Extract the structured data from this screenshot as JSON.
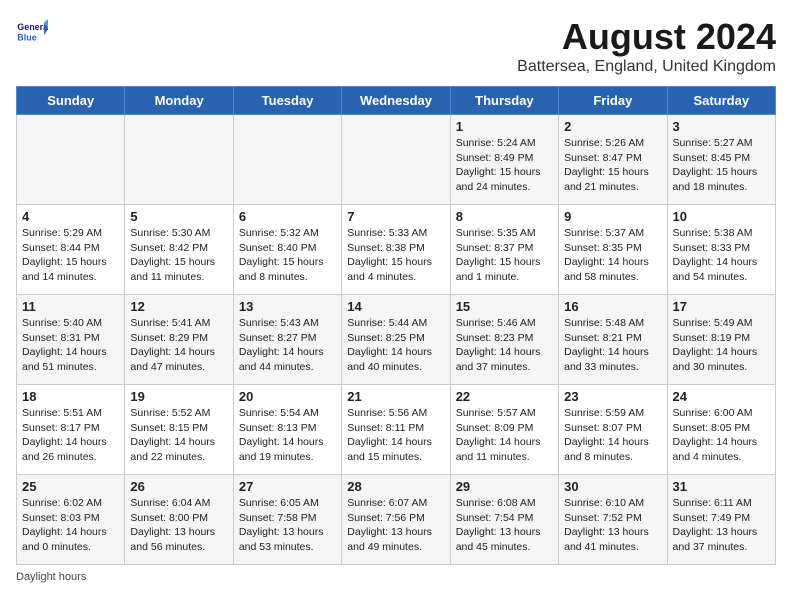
{
  "header": {
    "logo_line1": "General",
    "logo_line2": "Blue",
    "title": "August 2024",
    "subtitle": "Battersea, England, United Kingdom"
  },
  "days_of_week": [
    "Sunday",
    "Monday",
    "Tuesday",
    "Wednesday",
    "Thursday",
    "Friday",
    "Saturday"
  ],
  "weeks": [
    [
      {
        "day": "",
        "info": ""
      },
      {
        "day": "",
        "info": ""
      },
      {
        "day": "",
        "info": ""
      },
      {
        "day": "",
        "info": ""
      },
      {
        "day": "1",
        "info": "Sunrise: 5:24 AM\nSunset: 8:49 PM\nDaylight: 15 hours\nand 24 minutes."
      },
      {
        "day": "2",
        "info": "Sunrise: 5:26 AM\nSunset: 8:47 PM\nDaylight: 15 hours\nand 21 minutes."
      },
      {
        "day": "3",
        "info": "Sunrise: 5:27 AM\nSunset: 8:45 PM\nDaylight: 15 hours\nand 18 minutes."
      }
    ],
    [
      {
        "day": "4",
        "info": "Sunrise: 5:29 AM\nSunset: 8:44 PM\nDaylight: 15 hours\nand 14 minutes."
      },
      {
        "day": "5",
        "info": "Sunrise: 5:30 AM\nSunset: 8:42 PM\nDaylight: 15 hours\nand 11 minutes."
      },
      {
        "day": "6",
        "info": "Sunrise: 5:32 AM\nSunset: 8:40 PM\nDaylight: 15 hours\nand 8 minutes."
      },
      {
        "day": "7",
        "info": "Sunrise: 5:33 AM\nSunset: 8:38 PM\nDaylight: 15 hours\nand 4 minutes."
      },
      {
        "day": "8",
        "info": "Sunrise: 5:35 AM\nSunset: 8:37 PM\nDaylight: 15 hours\nand 1 minute."
      },
      {
        "day": "9",
        "info": "Sunrise: 5:37 AM\nSunset: 8:35 PM\nDaylight: 14 hours\nand 58 minutes."
      },
      {
        "day": "10",
        "info": "Sunrise: 5:38 AM\nSunset: 8:33 PM\nDaylight: 14 hours\nand 54 minutes."
      }
    ],
    [
      {
        "day": "11",
        "info": "Sunrise: 5:40 AM\nSunset: 8:31 PM\nDaylight: 14 hours\nand 51 minutes."
      },
      {
        "day": "12",
        "info": "Sunrise: 5:41 AM\nSunset: 8:29 PM\nDaylight: 14 hours\nand 47 minutes."
      },
      {
        "day": "13",
        "info": "Sunrise: 5:43 AM\nSunset: 8:27 PM\nDaylight: 14 hours\nand 44 minutes."
      },
      {
        "day": "14",
        "info": "Sunrise: 5:44 AM\nSunset: 8:25 PM\nDaylight: 14 hours\nand 40 minutes."
      },
      {
        "day": "15",
        "info": "Sunrise: 5:46 AM\nSunset: 8:23 PM\nDaylight: 14 hours\nand 37 minutes."
      },
      {
        "day": "16",
        "info": "Sunrise: 5:48 AM\nSunset: 8:21 PM\nDaylight: 14 hours\nand 33 minutes."
      },
      {
        "day": "17",
        "info": "Sunrise: 5:49 AM\nSunset: 8:19 PM\nDaylight: 14 hours\nand 30 minutes."
      }
    ],
    [
      {
        "day": "18",
        "info": "Sunrise: 5:51 AM\nSunset: 8:17 PM\nDaylight: 14 hours\nand 26 minutes."
      },
      {
        "day": "19",
        "info": "Sunrise: 5:52 AM\nSunset: 8:15 PM\nDaylight: 14 hours\nand 22 minutes."
      },
      {
        "day": "20",
        "info": "Sunrise: 5:54 AM\nSunset: 8:13 PM\nDaylight: 14 hours\nand 19 minutes."
      },
      {
        "day": "21",
        "info": "Sunrise: 5:56 AM\nSunset: 8:11 PM\nDaylight: 14 hours\nand 15 minutes."
      },
      {
        "day": "22",
        "info": "Sunrise: 5:57 AM\nSunset: 8:09 PM\nDaylight: 14 hours\nand 11 minutes."
      },
      {
        "day": "23",
        "info": "Sunrise: 5:59 AM\nSunset: 8:07 PM\nDaylight: 14 hours\nand 8 minutes."
      },
      {
        "day": "24",
        "info": "Sunrise: 6:00 AM\nSunset: 8:05 PM\nDaylight: 14 hours\nand 4 minutes."
      }
    ],
    [
      {
        "day": "25",
        "info": "Sunrise: 6:02 AM\nSunset: 8:03 PM\nDaylight: 14 hours\nand 0 minutes."
      },
      {
        "day": "26",
        "info": "Sunrise: 6:04 AM\nSunset: 8:00 PM\nDaylight: 13 hours\nand 56 minutes."
      },
      {
        "day": "27",
        "info": "Sunrise: 6:05 AM\nSunset: 7:58 PM\nDaylight: 13 hours\nand 53 minutes."
      },
      {
        "day": "28",
        "info": "Sunrise: 6:07 AM\nSunset: 7:56 PM\nDaylight: 13 hours\nand 49 minutes."
      },
      {
        "day": "29",
        "info": "Sunrise: 6:08 AM\nSunset: 7:54 PM\nDaylight: 13 hours\nand 45 minutes."
      },
      {
        "day": "30",
        "info": "Sunrise: 6:10 AM\nSunset: 7:52 PM\nDaylight: 13 hours\nand 41 minutes."
      },
      {
        "day": "31",
        "info": "Sunrise: 6:11 AM\nSunset: 7:49 PM\nDaylight: 13 hours\nand 37 minutes."
      }
    ]
  ],
  "footer": {
    "note": "Daylight hours"
  }
}
